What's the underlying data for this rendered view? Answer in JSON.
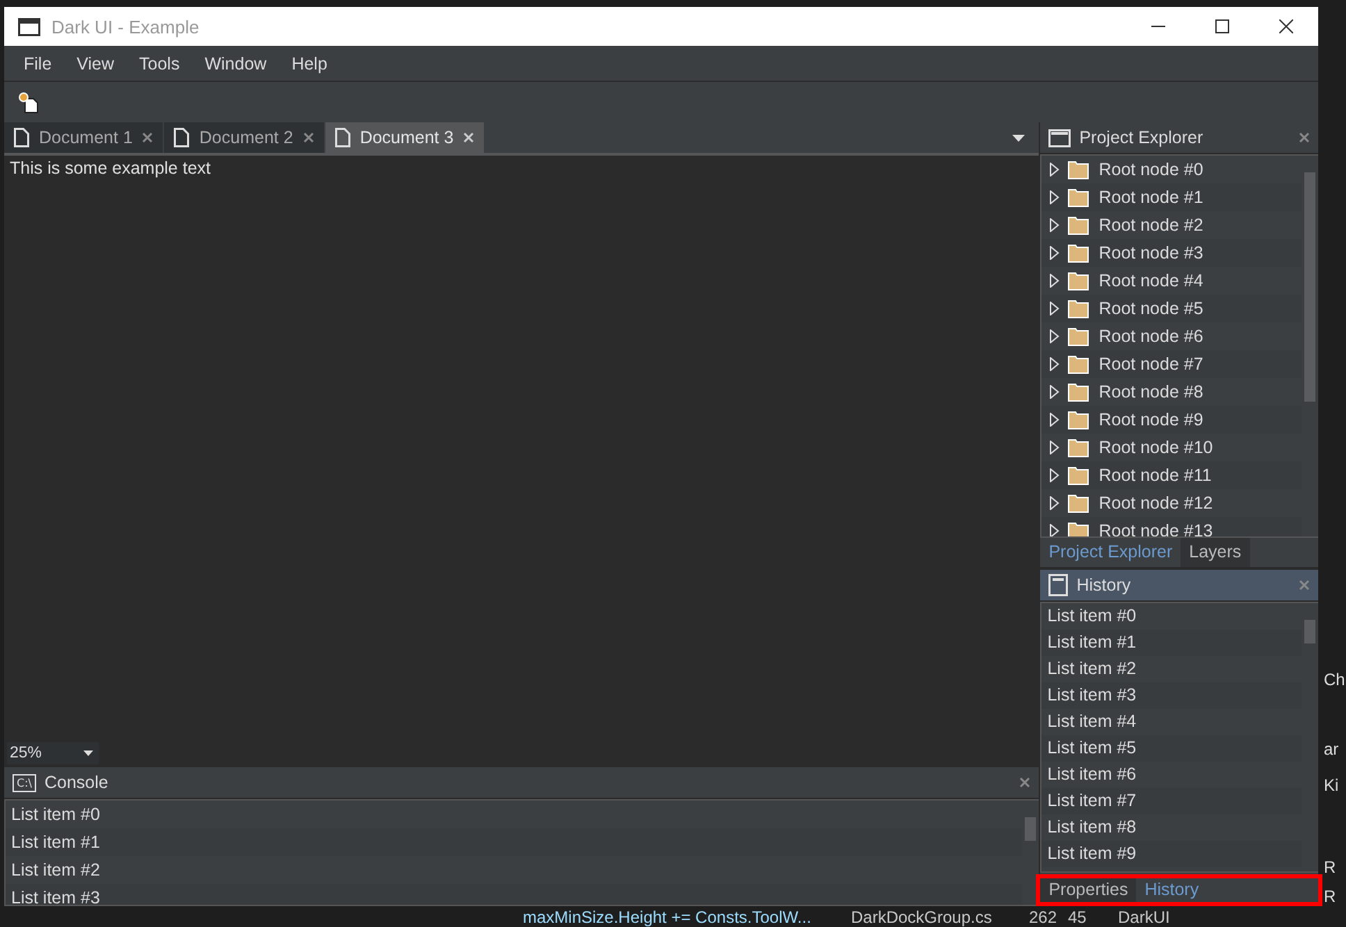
{
  "window": {
    "title": "Dark UI - Example"
  },
  "menu": [
    "File",
    "View",
    "Tools",
    "Window",
    "Help"
  ],
  "document_tabs": [
    {
      "label": "Document 1",
      "selected": false
    },
    {
      "label": "Document 2",
      "selected": false
    },
    {
      "label": "Document 3",
      "selected": true
    }
  ],
  "document": {
    "text": "This is some example text",
    "zoom": "25%"
  },
  "console": {
    "icon_text": "C:\\",
    "title": "Console",
    "active": false,
    "items": [
      "List item #0",
      "List item #1",
      "List item #2",
      "List item #3"
    ]
  },
  "project_explorer": {
    "title": "Project Explorer",
    "active": false,
    "nodes": [
      {
        "label": "Root node #0",
        "expanded": false
      },
      {
        "label": "Root node #1",
        "expanded": false
      },
      {
        "label": "Root node #2",
        "expanded": false
      },
      {
        "label": "Root node #3",
        "expanded": false
      },
      {
        "label": "Root node #4",
        "expanded": false
      },
      {
        "label": "Root node #5",
        "expanded": false
      },
      {
        "label": "Root node #6",
        "expanded": false
      },
      {
        "label": "Root node #7",
        "expanded": false
      },
      {
        "label": "Root node #8",
        "expanded": false
      },
      {
        "label": "Root node #9",
        "expanded": false
      },
      {
        "label": "Root node #10",
        "expanded": false
      },
      {
        "label": "Root node #11",
        "expanded": false
      },
      {
        "label": "Root node #12",
        "expanded": false
      },
      {
        "label": "Root node #13",
        "expanded": false
      }
    ],
    "tabs": [
      {
        "label": "Project Explorer",
        "selected": true
      },
      {
        "label": "Layers",
        "selected": false
      }
    ]
  },
  "history": {
    "title": "History",
    "active": true,
    "items": [
      "List item #0",
      "List item #1",
      "List item #2",
      "List item #3",
      "List item #4",
      "List item #5",
      "List item #6",
      "List item #7",
      "List item #8",
      "List item #9"
    ],
    "tabs": [
      {
        "label": "Properties",
        "selected": false
      },
      {
        "label": "History",
        "selected": true
      }
    ]
  },
  "background": {
    "code_line": "maxMinSize.Height += Consts.ToolW...",
    "file": "DarkDockGroup.cs",
    "line": "262",
    "column": "45",
    "project": "DarkUI",
    "side_texts": [
      "Ch",
      "ar",
      "Ki",
      "R",
      "R"
    ]
  }
}
